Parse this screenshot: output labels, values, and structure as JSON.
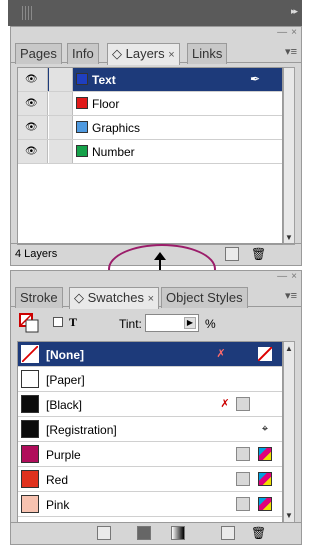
{
  "colors": {
    "selection": "#1d3a7a",
    "annotation_oval": "#9b1d6a"
  },
  "top_panel": {
    "tabs": [
      {
        "label": "Pages"
      },
      {
        "label": "Info"
      },
      {
        "label": "◇ Layers",
        "close": "×"
      },
      {
        "label": "Links"
      }
    ],
    "layers": [
      {
        "name": "Text",
        "color": "#1f3fbf",
        "selected": true
      },
      {
        "name": "Floor",
        "color": "#e01a1a",
        "selected": false
      },
      {
        "name": "Graphics",
        "color": "#4f9ae0",
        "selected": false
      },
      {
        "name": "Number",
        "color": "#16a24a",
        "selected": false
      }
    ],
    "footer": {
      "count": "4 Layers"
    }
  },
  "bottom_panel": {
    "tabs": [
      {
        "label": "Stroke"
      },
      {
        "label": "◇ Swatches",
        "close": "×"
      },
      {
        "label": "Object Styles"
      }
    ],
    "toolbar": {
      "tint_label": "Tint:",
      "tint_unit": "%",
      "text_mode": "T"
    },
    "swatches": [
      {
        "name": "[None]",
        "color": "#ffffff",
        "selected": true
      },
      {
        "name": "[Paper]",
        "color": "#ffffff",
        "selected": false
      },
      {
        "name": "[Black]",
        "color": "#0b0b0b",
        "selected": false
      },
      {
        "name": "[Registration]",
        "color": "#0b0b0b",
        "selected": false
      },
      {
        "name": "Purple",
        "color": "#b00d5b",
        "selected": false
      },
      {
        "name": "Red",
        "color": "#e0321e",
        "selected": false
      },
      {
        "name": "Pink",
        "color": "#f7c2b0",
        "selected": false
      }
    ]
  },
  "icons": {
    "eye": "eye-icon",
    "pen": "pen-icon",
    "trash": "trash-icon",
    "new": "new-item-icon",
    "resize": "resize-vertical-icon"
  }
}
